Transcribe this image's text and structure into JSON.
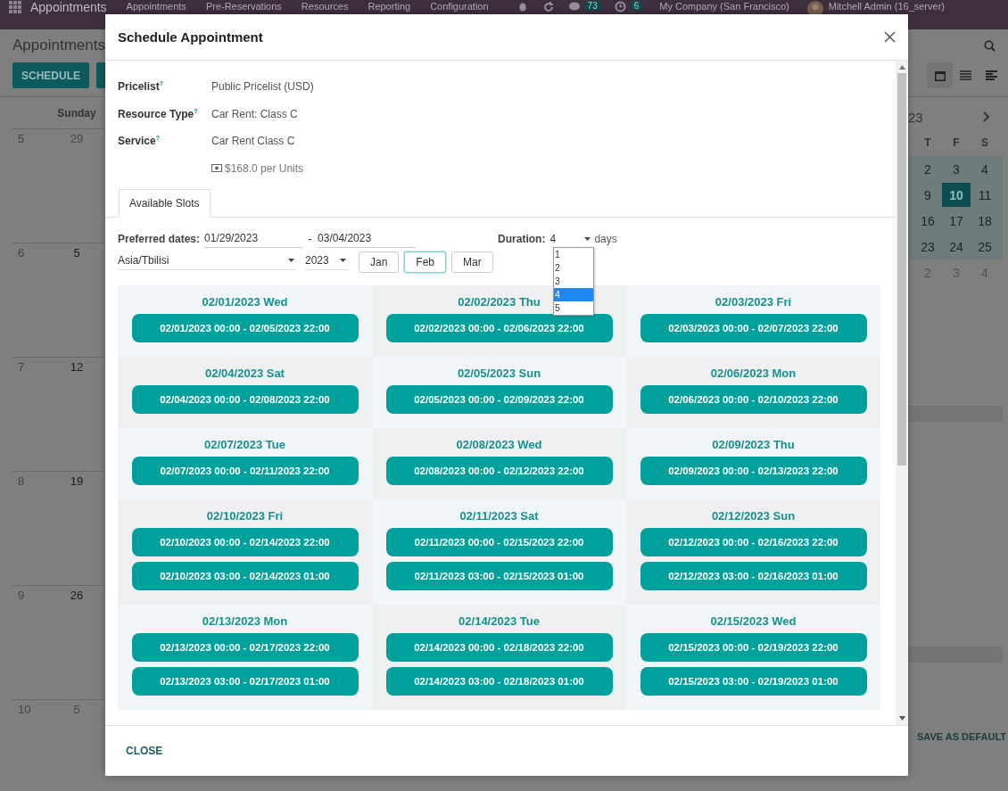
{
  "navbar": {
    "app": "Appointments",
    "menu": [
      "Appointments",
      "Pre-Reservations",
      "Resources",
      "Reporting",
      "Configuration"
    ],
    "chat_count": "73",
    "activity_count": "6",
    "company": "My Company (San Francisco)",
    "user": "Mitchell Admin (16_server)"
  },
  "control_panel": {
    "breadcrumb": "Appointments",
    "schedule_button": "SCHEDULE"
  },
  "calendar": {
    "column_header": "Sunday",
    "weeks": [
      {
        "week": "5",
        "day": "29",
        "muted": true
      },
      {
        "week": "6",
        "day": "5",
        "muted": false
      },
      {
        "week": "7",
        "day": "12",
        "muted": false
      },
      {
        "week": "8",
        "day": "19",
        "muted": false
      },
      {
        "week": "9",
        "day": "26",
        "muted": false
      },
      {
        "week": "10",
        "day": "5",
        "muted": true
      }
    ]
  },
  "sidebar": {
    "month_title": "23",
    "weekdays": [
      "T",
      "F",
      "S"
    ],
    "weeks": [
      [
        {
          "label": "2",
          "muted": false,
          "selected": false
        },
        {
          "label": "3",
          "muted": false,
          "selected": false
        },
        {
          "label": "4",
          "muted": false,
          "selected": false
        }
      ],
      [
        {
          "label": "9",
          "muted": false,
          "selected": false
        },
        {
          "label": "10",
          "muted": false,
          "selected": true
        },
        {
          "label": "11",
          "muted": false,
          "selected": false
        }
      ],
      [
        {
          "label": "16",
          "muted": false,
          "selected": false
        },
        {
          "label": "17",
          "muted": false,
          "selected": false
        },
        {
          "label": "18",
          "muted": false,
          "selected": false
        }
      ],
      [
        {
          "label": "23",
          "muted": false,
          "selected": false
        },
        {
          "label": "24",
          "muted": false,
          "selected": false
        },
        {
          "label": "25",
          "muted": false,
          "selected": false
        }
      ],
      [
        {
          "label": "2",
          "muted": true,
          "selected": false
        },
        {
          "label": "3",
          "muted": true,
          "selected": false
        },
        {
          "label": "4",
          "muted": true,
          "selected": false
        }
      ]
    ],
    "save_default": "SAVE AS DEFAULT"
  },
  "dialog": {
    "title": "Schedule Appointment",
    "close_button": "CLOSE",
    "fields": [
      {
        "label": "Pricelist$^{?}$",
        "value": "Public Pricelist (USD)"
      },
      {
        "label": "Resource Type$^{?}$",
        "value": "Car Rent: Class C"
      },
      {
        "label": "Service$^{?}$",
        "value": "Car Rent Class C"
      }
    ],
    "price_note": "$168.0 per Units",
    "tabs": [
      {
        "label": "Available Slots",
        "selected": true
      }
    ],
    "preferred_dates": {
      "label": "Preferred dates:",
      "from": "01/29/2023",
      "separator": "-",
      "to": "03/04/2023"
    },
    "duration": {
      "label": "Duration:",
      "value": "4",
      "unit": "days",
      "expanded": true,
      "options": [
        {
          "label": "1",
          "selected": false
        },
        {
          "label": "2",
          "selected": false
        },
        {
          "label": "3",
          "selected": false
        },
        {
          "label": "4",
          "selected": true
        },
        {
          "label": "5",
          "selected": false
        }
      ]
    },
    "timezone": "Asia/Tbilisi",
    "year": "2023",
    "months": [
      {
        "label": "Jan",
        "selected": false
      },
      {
        "label": "Feb",
        "selected": true
      },
      {
        "label": "Mar",
        "selected": false
      }
    ],
    "days": [
      {
        "date": "02/01/2023 Wed",
        "slots": [
          "02/01/2023 00:00 - 02/05/2023 22:00"
        ]
      },
      {
        "date": "02/02/2023 Thu",
        "slots": [
          "02/02/2023 00:00 - 02/06/2023 22:00"
        ]
      },
      {
        "date": "02/03/2023 Fri",
        "slots": [
          "02/03/2023 00:00 - 02/07/2023 22:00"
        ]
      },
      {
        "date": "02/04/2023 Sat",
        "slots": [
          "02/04/2023 00:00 - 02/08/2023 22:00"
        ]
      },
      {
        "date": "02/05/2023 Sun",
        "slots": [
          "02/05/2023 00:00 - 02/09/2023 22:00"
        ]
      },
      {
        "date": "02/06/2023 Mon",
        "slots": [
          "02/06/2023 00:00 - 02/10/2023 22:00"
        ]
      },
      {
        "date": "02/07/2023 Tue",
        "slots": [
          "02/07/2023 00:00 - 02/11/2023 22:00"
        ]
      },
      {
        "date": "02/08/2023 Wed",
        "slots": [
          "02/08/2023 00:00 - 02/12/2023 22:00"
        ]
      },
      {
        "date": "02/09/2023 Thu",
        "slots": [
          "02/09/2023 00:00 - 02/13/2023 22:00"
        ]
      },
      {
        "date": "02/10/2023 Fri",
        "slots": [
          "02/10/2023 00:00 - 02/14/2023 22:00",
          "02/10/2023 03:00 - 02/14/2023 01:00"
        ]
      },
      {
        "date": "02/11/2023 Sat",
        "slots": [
          "02/11/2023 00:00 - 02/15/2023 22:00",
          "02/11/2023 03:00 - 02/15/2023 01:00"
        ]
      },
      {
        "date": "02/12/2023 Sun",
        "slots": [
          "02/12/2023 00:00 - 02/16/2023 22:00",
          "02/12/2023 03:00 - 02/16/2023 01:00"
        ]
      },
      {
        "date": "02/13/2023 Mon",
        "slots": [
          "02/13/2023 00:00 - 02/17/2023 22:00",
          "02/13/2023 03:00 - 02/17/2023 01:00"
        ]
      },
      {
        "date": "02/14/2023 Tue",
        "slots": [
          "02/14/2023 00:00 - 02/18/2023 22:00",
          "02/14/2023 03:00 - 02/18/2023 01:00"
        ]
      },
      {
        "date": "02/15/2023 Wed",
        "slots": [
          "02/15/2023 00:00 - 02/19/2023 22:00",
          "02/15/2023 03:00 - 02/19/2023 01:00"
        ]
      }
    ]
  }
}
